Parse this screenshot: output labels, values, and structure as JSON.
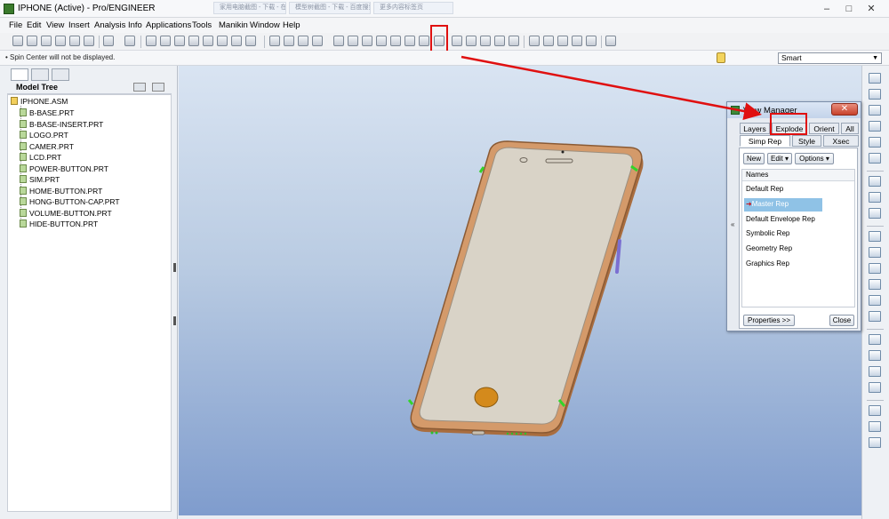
{
  "window": {
    "title": "IPHONE (Active) - Pro/ENGINEER",
    "background_tabs": [
      "家用电脑截图 - 下载 - 在线 - 百度搜索",
      "模型树截图 - 下载 - 百度搜索",
      "更多内容标签页"
    ],
    "controls": [
      "–",
      "□",
      "✕"
    ]
  },
  "menubar": {
    "items": [
      "File",
      "Edit",
      "View",
      "Insert",
      "Analysis",
      "Info",
      "Applications",
      "Tools",
      "Manikin",
      "Window",
      "Help"
    ]
  },
  "status": {
    "message": "• Spin Center will not be displayed.",
    "filter_value": "Smart"
  },
  "model_tree": {
    "title": "Model Tree",
    "root": "IPHONE.ASM",
    "items": [
      "B-BASE.PRT",
      "B-BASE-INSERT.PRT",
      "LOGO.PRT",
      "CAMER.PRT",
      "LCD.PRT",
      "POWER-BUTTON.PRT",
      "SIM.PRT",
      "HOME-BUTTON.PRT",
      "HONG-BUTTON-CAP.PRT",
      "VOLUME-BUTTON.PRT",
      "HIDE-BUTTON.PRT"
    ]
  },
  "view_manager": {
    "title": "View Manager",
    "close_symbol": "✕",
    "tabs_row1": [
      "Layers",
      "Explode",
      "Orient",
      "All"
    ],
    "tabs_row2": [
      "Simp Rep",
      "Style",
      "Xsec"
    ],
    "active_tab": "Simp Rep",
    "buttons": {
      "new": "New",
      "edit": "Edit ▾",
      "options": "Options ▾",
      "properties": "Properties >>",
      "close": "Close"
    },
    "list_header": "Names",
    "reps": [
      "Default Rep",
      "Master Rep",
      "Default Envelope Rep",
      "Symbolic Rep",
      "Geometry Rep",
      "Graphics Rep"
    ],
    "selected_rep": "Master Rep",
    "active_marker": "➜"
  },
  "collapse_glyph": "«",
  "colors": {
    "highlight": "#e01010",
    "phone_frame": "#d49a6a",
    "phone_screen": "#d9d3c7",
    "home_button": "#d48a1c",
    "selection": "#8fc2e6"
  },
  "icons": {
    "highlighted_toolbar_icon": "view-manager-icon"
  }
}
